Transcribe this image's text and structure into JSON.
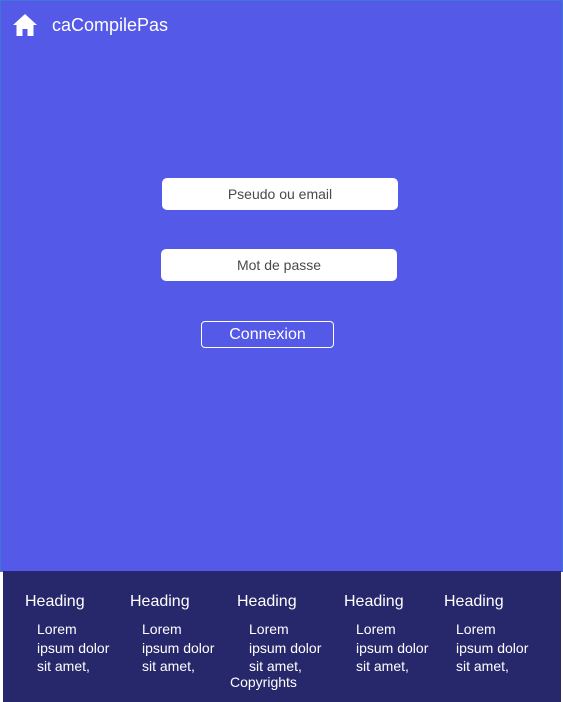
{
  "app": {
    "title": "caCompilePas",
    "home_icon": "home-icon"
  },
  "login": {
    "user_placeholder": "Pseudo ou email",
    "password_placeholder": "Mot de passe",
    "submit_label": "Connexion"
  },
  "footer": {
    "columns": [
      {
        "heading": "Heading",
        "text": "Lorem ipsum dolor sit amet,"
      },
      {
        "heading": "Heading",
        "text": "Lorem ipsum dolor sit amet,"
      },
      {
        "heading": "Heading",
        "text": "Lorem ipsum dolor sit amet,"
      },
      {
        "heading": "Heading",
        "text": "Lorem ipsum dolor sit amet,"
      },
      {
        "heading": "Heading",
        "text": "Lorem ipsum dolor sit amet,"
      }
    ],
    "copyright": "Copyrights"
  },
  "colors": {
    "main_background": "#5459e8",
    "footer_background": "#27276b",
    "text": "#ffffff"
  }
}
